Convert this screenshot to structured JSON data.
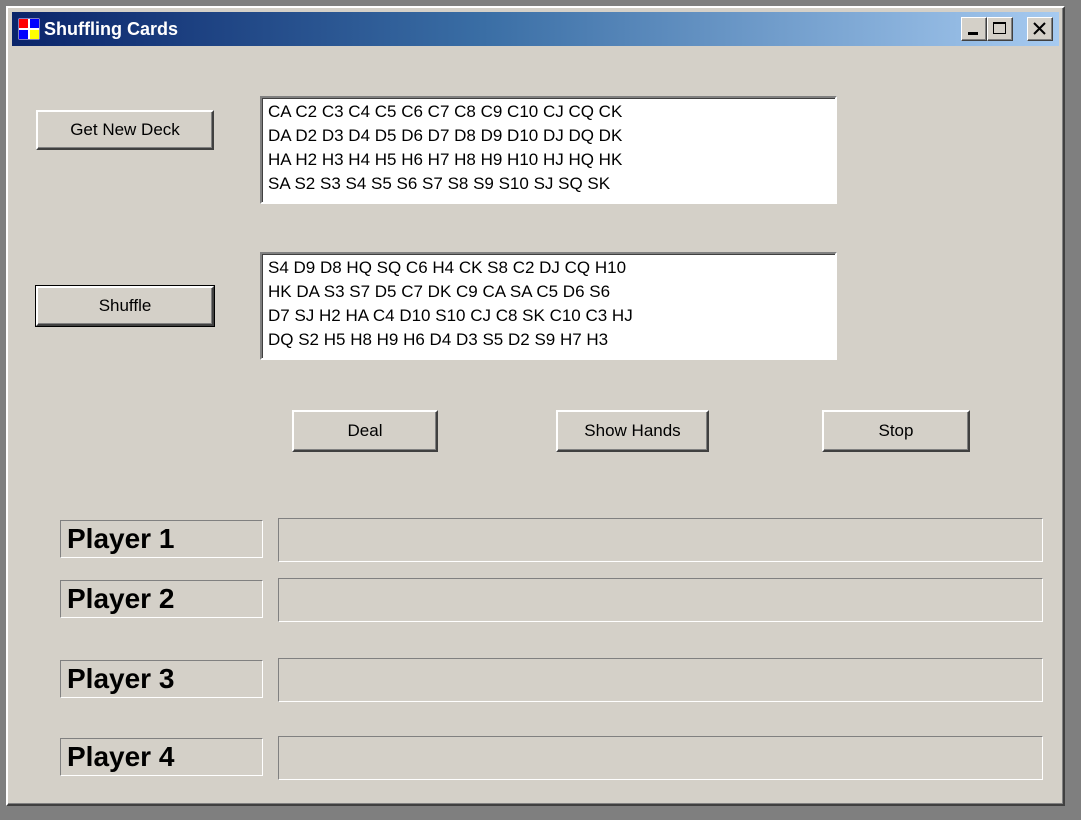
{
  "window": {
    "title": "Shuffling Cards",
    "title_gradient": [
      "#0a246a",
      "#a6caf0"
    ],
    "background": "#d4d0c8"
  },
  "caption_buttons": {
    "minimize_icon": "minimize-icon",
    "maximize_icon": "maximize-icon",
    "close_icon": "close-icon"
  },
  "buttons": {
    "get_new_deck": "Get New Deck",
    "shuffle": "Shuffle",
    "deal": "Deal",
    "show_hands": "Show Hands",
    "stop": "Stop"
  },
  "new_deck_box": {
    "lines": [
      "CA  C2  C3  C4  C5  C6  C7  C8  C9  C10  CJ  CQ  CK",
      "DA  D2  D3  D4  D5  D6  D7  D8  D9  D10  DJ  DQ  DK",
      "HA  H2  H3  H4  H5  H6  H7  H8  H9  H10  HJ  HQ  HK",
      "SA  S2  S3  S4  S5  S6  S7  S8  S9  S10  SJ  SQ  SK"
    ]
  },
  "shuffled_box": {
    "lines": [
      "S4  D9  D8  HQ  SQ  C6  H4  CK  S8  C2  DJ  CQ  H10",
      "HK  DA  S3  S7  D5  C7  DK  C9  CA  SA  C5  D6  S6",
      "D7  SJ  H2  HA  C4  D10  S10  CJ  C8  SK  C10  C3  HJ",
      "DQ  S2  H5  H8  H9  H6  D4  D3  S5  D2  S9  H7  H3"
    ]
  },
  "players": [
    {
      "label": "Player 1",
      "hand": ""
    },
    {
      "label": "Player 2",
      "hand": ""
    },
    {
      "label": "Player 3",
      "hand": ""
    },
    {
      "label": "Player 4",
      "hand": ""
    }
  ]
}
